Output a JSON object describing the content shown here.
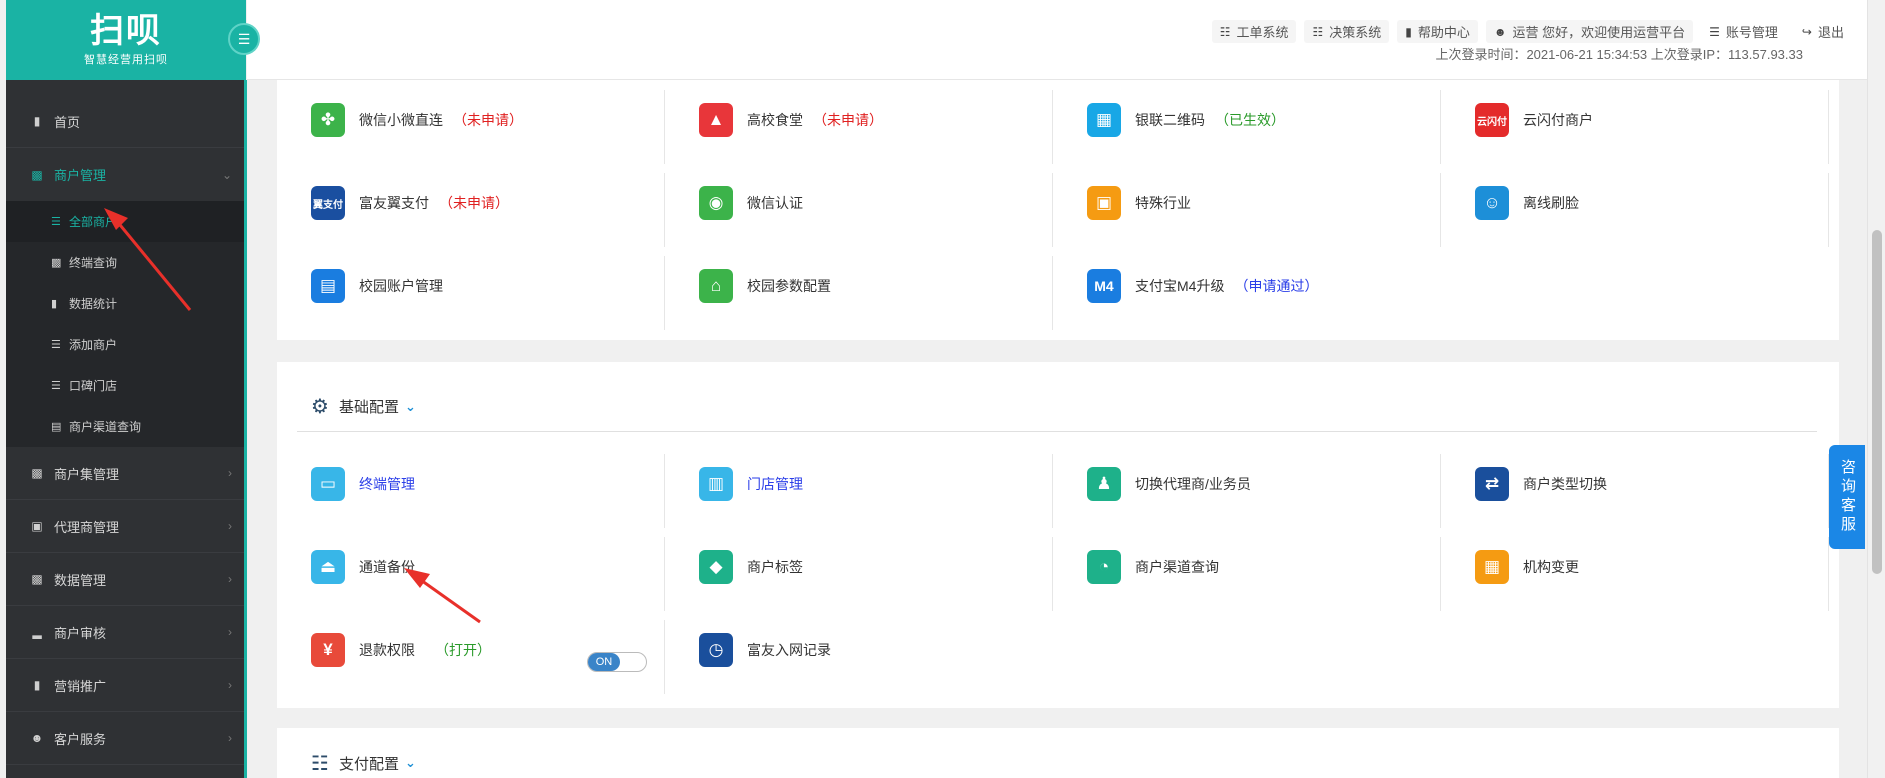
{
  "logo": {
    "main": "扫呗",
    "sub": "智慧经营用扫呗"
  },
  "sidebar": {
    "items": [
      {
        "label": "首页",
        "icon": "bookmark-icon"
      },
      {
        "label": "商户管理",
        "icon": "store-icon",
        "expanded": true,
        "children": [
          {
            "label": "全部商户",
            "icon": "list-icon",
            "active": true
          },
          {
            "label": "终端查询",
            "icon": "box-icon"
          },
          {
            "label": "数据统计",
            "icon": "bookmark-icon"
          },
          {
            "label": "添加商户",
            "icon": "list-icon"
          },
          {
            "label": "口碑门店",
            "icon": "list-icon"
          },
          {
            "label": "商户渠道查询",
            "icon": "chart-icon"
          }
        ]
      },
      {
        "label": "商户集管理",
        "icon": "store-icon"
      },
      {
        "label": "代理商管理",
        "icon": "briefcase-icon"
      },
      {
        "label": "数据管理",
        "icon": "store-icon"
      },
      {
        "label": "商户审核",
        "icon": "signal-icon"
      },
      {
        "label": "营销推广",
        "icon": "bookmark-icon"
      },
      {
        "label": "客户服务",
        "icon": "user-icon"
      }
    ]
  },
  "header": {
    "links": [
      {
        "label": "工单系统",
        "icon": "document-icon"
      },
      {
        "label": "决策系统",
        "icon": "document-icon"
      },
      {
        "label": "帮助中心",
        "icon": "book-icon"
      },
      {
        "label": "运营 您好，欢迎使用运营平台",
        "icon": "user-icon"
      },
      {
        "label": "账号管理",
        "icon": "menu-icon"
      },
      {
        "label": "退出",
        "icon": "logout-icon"
      }
    ],
    "login_info": "上次登录时间：2021-06-21 15:34:53  上次登录IP：113.57.93.33"
  },
  "card1": {
    "cells": [
      {
        "label": "微信小微直连",
        "status": "（未申请）",
        "status_color": "red",
        "tile": "#3cb34a",
        "glyph": "✤"
      },
      {
        "label": "高校食堂",
        "status": "（未申请）",
        "status_color": "red",
        "tile": "#e8363a",
        "glyph": "🎓"
      },
      {
        "label": "银联二维码",
        "status": "（已生效）",
        "status_color": "green",
        "tile": "#18a7e6",
        "glyph": "▦"
      },
      {
        "label": "云闪付商户",
        "status": "",
        "status_color": "",
        "tile": "#e42b2b",
        "glyph": "云"
      },
      {
        "label": "富友翼支付",
        "status": "（未申请）",
        "status_color": "red",
        "tile": "#1a4fa0",
        "glyph": "翼"
      },
      {
        "label": "微信认证",
        "status": "",
        "status_color": "",
        "tile": "#3cb34a",
        "glyph": "◉"
      },
      {
        "label": "特殊行业",
        "status": "",
        "status_color": "",
        "tile": "#f59b12",
        "glyph": "▣"
      },
      {
        "label": "离线刷脸",
        "status": "",
        "status_color": "",
        "tile": "#1d8fd8",
        "glyph": "☺"
      },
      {
        "label": "校园账户管理",
        "status": "",
        "status_color": "",
        "tile": "#1a7de0",
        "glyph": "▤"
      },
      {
        "label": "校园参数配置",
        "status": "",
        "status_color": "",
        "tile": "#3cb34a",
        "glyph": "⌂"
      },
      {
        "label": "支付宝M4升级",
        "status": "（申请通过）",
        "status_color": "blue",
        "tile": "#1a7de0",
        "glyph": "M4"
      }
    ]
  },
  "card2": {
    "title": "基础配置",
    "cells": [
      {
        "label": "终端管理",
        "link": true,
        "status": "",
        "status_color": "",
        "tile": "#38b6e8",
        "glyph": "▭"
      },
      {
        "label": "门店管理",
        "link": true,
        "status": "",
        "status_color": "",
        "tile": "#38b6e8",
        "glyph": "▥"
      },
      {
        "label": "切换代理商/业务员",
        "link": false,
        "status": "",
        "status_color": "",
        "tile": "#1eb18a",
        "glyph": "♟"
      },
      {
        "label": "商户类型切换",
        "link": false,
        "status": "",
        "status_color": "",
        "tile": "#1a4f9c",
        "glyph": "⇄"
      },
      {
        "label": "通道备份",
        "link": false,
        "status": "",
        "status_color": "",
        "tile": "#38b6e8",
        "glyph": "⏏"
      },
      {
        "label": "商户标签",
        "link": false,
        "status": "",
        "status_color": "",
        "tile": "#1eb18a",
        "glyph": "◆"
      },
      {
        "label": "商户渠道查询",
        "link": false,
        "status": "",
        "status_color": "",
        "tile": "#1eb18a",
        "glyph": "◔"
      },
      {
        "label": "机构变更",
        "link": false,
        "status": "",
        "status_color": "",
        "tile": "#f59b12",
        "glyph": "品"
      },
      {
        "label": "退款权限",
        "link": false,
        "status": "（打开）",
        "status_color": "green",
        "tile": "#e84a3a",
        "glyph": "¥"
      },
      {
        "label": "富友入网记录",
        "link": false,
        "status": "",
        "status_color": "",
        "tile": "#1a4f9c",
        "glyph": "◷"
      }
    ],
    "refund_toggle": "ON"
  },
  "card3": {
    "title": "支付配置"
  },
  "consult_tab": "咨询客服"
}
